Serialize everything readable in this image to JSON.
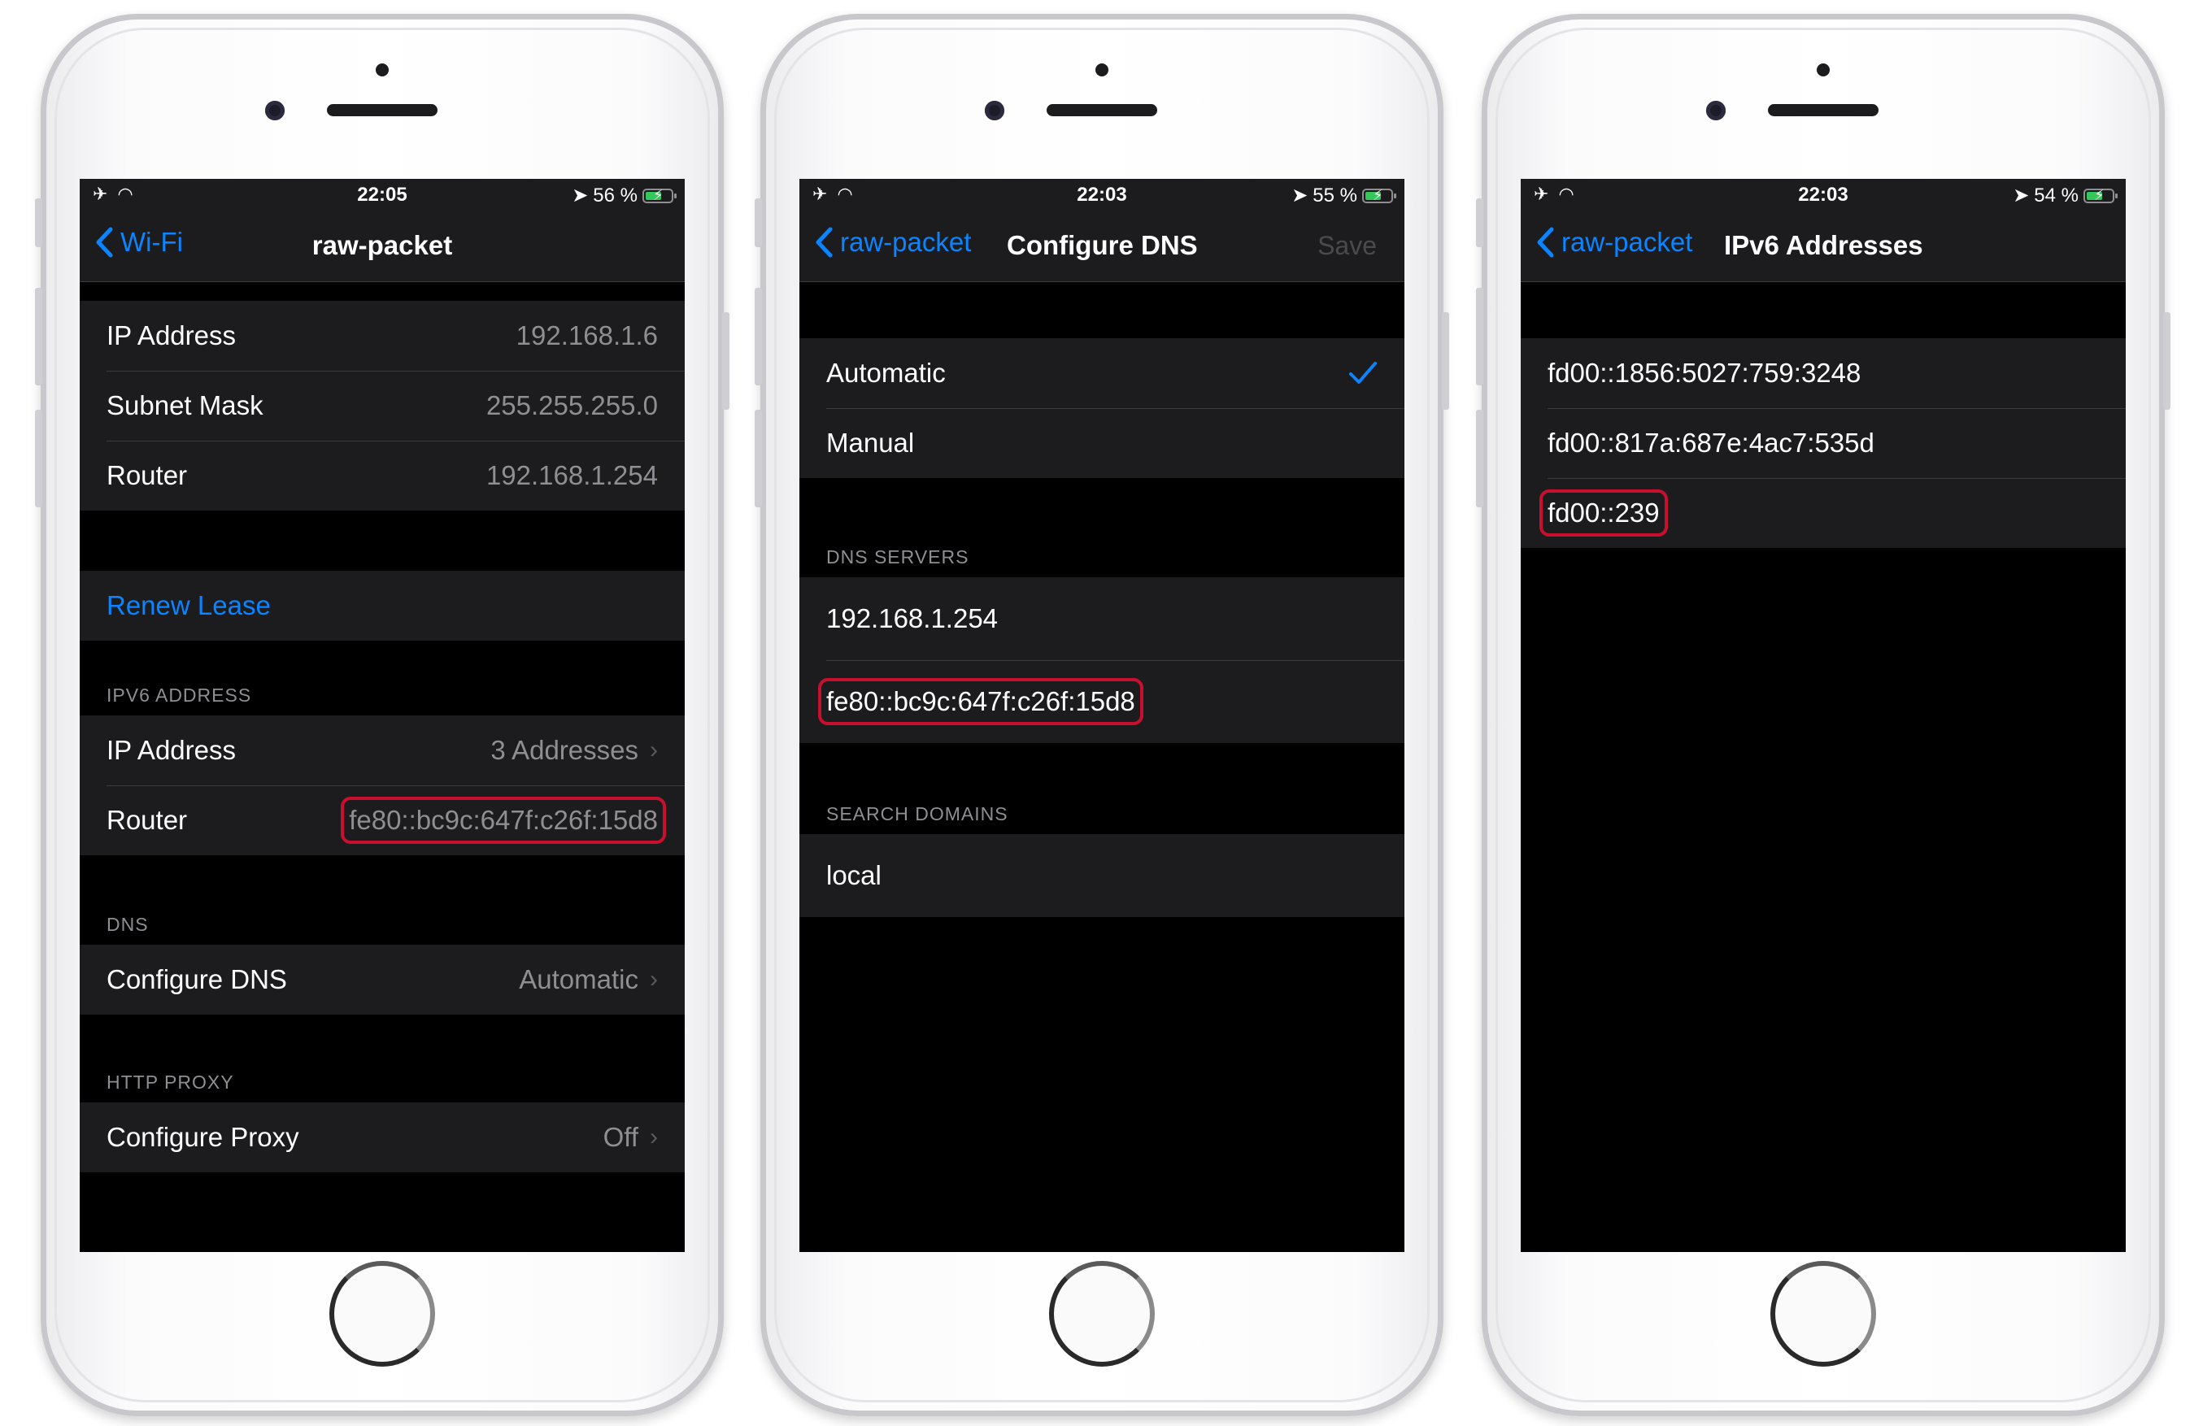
{
  "colors": {
    "accent": "#0a84ff",
    "highlight": "#c8102e",
    "battery_green": "#34c759"
  },
  "phone1": {
    "status": {
      "time": "22:05",
      "battery": "56 %"
    },
    "nav": {
      "back": "Wi-Fi",
      "title": "raw-packet"
    },
    "ipv4": [
      {
        "label": "IP Address",
        "value": "192.168.1.6"
      },
      {
        "label": "Subnet Mask",
        "value": "255.255.255.0"
      },
      {
        "label": "Router",
        "value": "192.168.1.254"
      }
    ],
    "renew_lease": "Renew Lease",
    "ipv6_header": "IPV6 ADDRESS",
    "ipv6": [
      {
        "label": "IP Address",
        "value": "3 Addresses"
      },
      {
        "label": "Router",
        "value": "fe80::bc9c:647f:c26f:15d8"
      }
    ],
    "dns_header": "DNS",
    "dns": {
      "label": "Configure DNS",
      "value": "Automatic"
    },
    "proxy_header": "HTTP PROXY",
    "proxy": {
      "label": "Configure Proxy",
      "value": "Off"
    }
  },
  "phone2": {
    "status": {
      "time": "22:03",
      "battery": "55 %"
    },
    "nav": {
      "back": "raw-packet",
      "title": "Configure DNS",
      "save": "Save"
    },
    "modes": [
      "Automatic",
      "Manual"
    ],
    "servers_header": "DNS SERVERS",
    "servers": [
      "192.168.1.254",
      "fe80::bc9c:647f:c26f:15d8"
    ],
    "domains_header": "SEARCH DOMAINS",
    "domains": [
      "local"
    ]
  },
  "phone3": {
    "status": {
      "time": "22:03",
      "battery": "54 %"
    },
    "nav": {
      "back": "raw-packet",
      "title": "IPv6 Addresses"
    },
    "addresses": [
      "fd00::1856:5027:759:3248",
      "fd00::817a:687e:4ac7:535d",
      "fd00::239"
    ]
  }
}
